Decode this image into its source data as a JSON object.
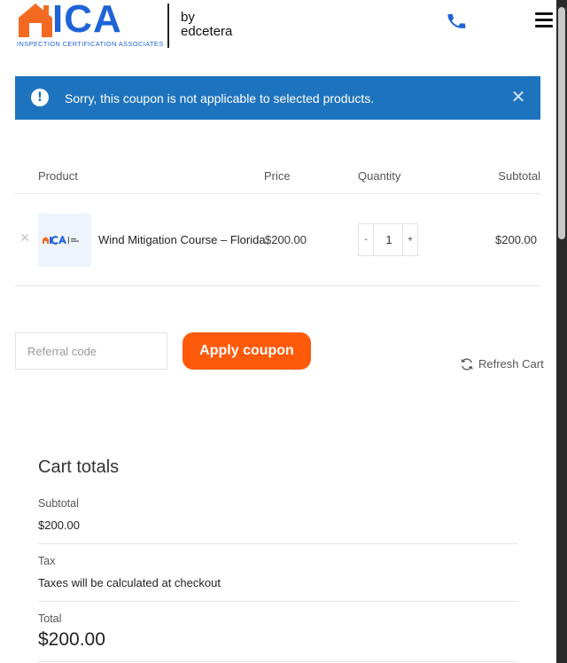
{
  "header": {
    "logo_letters": "ICA",
    "logo_tagline": "INSPECTION CERTIFICATION ASSOCIATES",
    "logo_by": "by",
    "logo_brand": "edcetera"
  },
  "notice": {
    "message": "Sorry, this coupon is not applicable to selected products.",
    "icon": "exclamation-icon",
    "close_symbol": "✕"
  },
  "cart": {
    "columns": {
      "product": "Product",
      "price": "Price",
      "quantity": "Quantity",
      "subtotal": "Subtotal"
    },
    "items": [
      {
        "name": "Wind Mitigation Course – Florida",
        "price": "$200.00",
        "quantity": "1",
        "subtotal": "$200.00",
        "remove_symbol": "×",
        "minus": "-",
        "plus": "+"
      }
    ]
  },
  "coupon": {
    "placeholder": "Referral code",
    "apply_label": "Apply coupon",
    "refresh_label": "Refresh Cart"
  },
  "totals": {
    "title": "Cart totals",
    "subtotal_label": "Subtotal",
    "subtotal_value": "$200.00",
    "tax_label": "Tax",
    "tax_value": "Taxes will be calculated at checkout",
    "total_label": "Total",
    "total_value": "$200.00"
  },
  "colors": {
    "brand_blue": "#1f63d8",
    "notice_blue": "#1e73be",
    "accent_orange": "#ff5a0a",
    "logo_house_orange": "#f26a21"
  }
}
